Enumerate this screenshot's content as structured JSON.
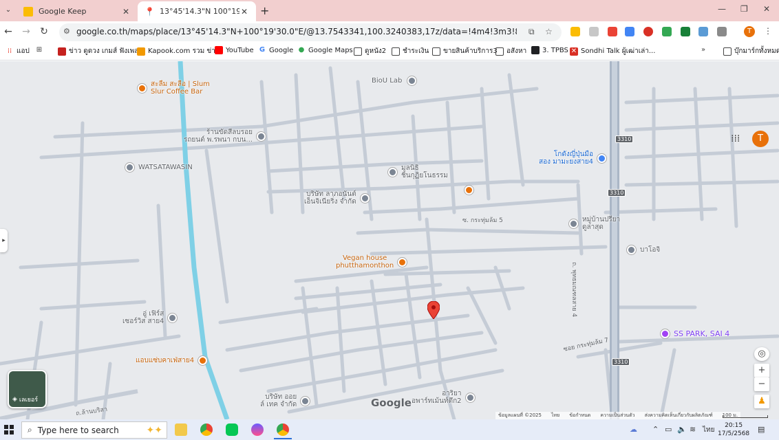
{
  "browser": {
    "tabs": [
      {
        "label": "Google Keep",
        "active": false,
        "favicon": "keep-icon"
      },
      {
        "label": "13°45'14.3\"N 100°19'30.0\"E - G",
        "active": true,
        "favicon": "maps-pin-icon"
      }
    ],
    "url": "google.co.th/maps/place/13°45'14.3\"N+100°19'30.0\"E/@13.7543341,100.3240383,17z/data=!4m4!3m3!8m2!3d13.7539722!4d100.325?entry...",
    "profile_initial": "T",
    "bookmarks": [
      "แอป",
      "ข่าว ดูดวง เกมส์ ฟังเพล...",
      "Kapook.com รวม ข่า...",
      "YouTube",
      "Google",
      "Google Maps",
      "ดูหนัง2",
      "ชำระเงิน",
      "ขายสินค้าบริการ3",
      "อสังหา",
      "3. TPBS",
      "Sondhi Talk ผู้เฒ่าเล่า...",
      "บุ๊กมาร์กทั้งหมด"
    ]
  },
  "map": {
    "pois": [
      {
        "name": "สะลืม สะลือ | Slum\nSlur Coffee Bar",
        "kind": "cafe"
      },
      {
        "name": "BioU Lab",
        "kind": "generic"
      },
      {
        "name": "ร้านขัดสีลบรอย\nรถยนต์ พ.รพนา กบน...",
        "kind": "generic"
      },
      {
        "name": "WATSATAWASIN",
        "kind": "generic"
      },
      {
        "name": "มูลนิธิ\nชินกุฏิยโนธรรม",
        "kind": "generic"
      },
      {
        "name": "โกดังญี่ปุ่นมือ\nสอง มามะยงสาย4",
        "kind": "shop"
      },
      {
        "name": "บริษัท ลาภอนันต์\nเอ็นจิเนียริ่ง จำกัด",
        "kind": "generic"
      },
      {
        "name": "หมู่บ้านปรียา\nดูล่าสุด",
        "kind": "generic"
      },
      {
        "name": "บาโอจิ",
        "kind": "generic"
      },
      {
        "name": "Vegan house\nphutthamonthon",
        "kind": "restaurant"
      },
      {
        "name": "อู่ เฟิร์ส\nเซอร์วิส สาย4",
        "kind": "generic"
      },
      {
        "name": "SS PARK, SAI 4",
        "kind": "entertainment"
      },
      {
        "name": "แอบแซ่บคาเฟ่สาย4",
        "kind": "restaurant"
      },
      {
        "name": "บริษัท ออย\nล์ เทค จำกัด",
        "kind": "generic"
      },
      {
        "name": "อาริยา\nอพาร์ทเม้นท์ตึก2",
        "kind": "generic"
      }
    ],
    "road_labels": {
      "soi5": "ซ. กระทุ่มล้ม 5",
      "soi7": "ซอย กระทุ่มล้ม 7",
      "main_road": "ถ. พุทธมณฑลสาย 4",
      "lower_left": "ถ.ล้านบริสา"
    },
    "route_shield": "3310",
    "google_logo": "Google",
    "layers_label": "เลเยอร์",
    "footer": {
      "copyright": "ข้อมูลแผนที่ ©2025",
      "language": "ไทย",
      "terms": "ข้อกำหนด",
      "privacy": "ความเป็นส่วนตัว",
      "feedback": "ส่งความคิดเห็นเกี่ยวกับผลิตภัณฑ์",
      "scale": "100 ม."
    }
  },
  "taskbar": {
    "search_placeholder": "Type here to search",
    "time": "20:15",
    "date": "17/5/2568",
    "lang": "ไทย"
  }
}
